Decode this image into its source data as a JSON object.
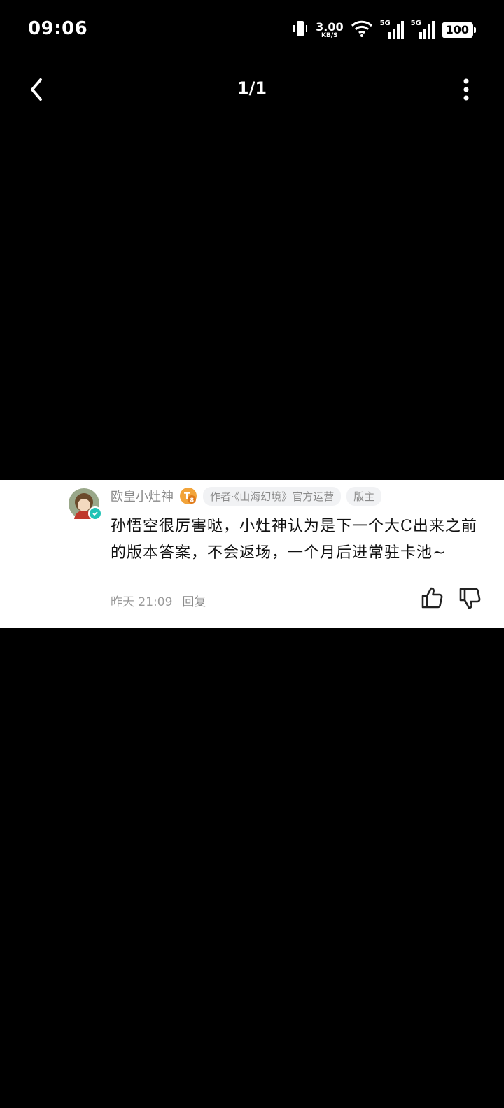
{
  "status_bar": {
    "time": "09:06",
    "net_speed": "3.00",
    "net_unit": "KB/S",
    "signal_1": "5G",
    "signal_2": "5G",
    "battery": "100"
  },
  "top_bar": {
    "page_counter": "1/1",
    "back_icon": "back-arrow-icon",
    "more_icon": "more-vertical-icon"
  },
  "comment": {
    "username": "欧皇小灶神",
    "level_badge": "T8",
    "author_tag": "作者·《山海幻境》官方运营",
    "moderator_tag": "版主",
    "text": "孙悟空很厉害哒，小灶神认为是下一个大C出来之前的版本答案，不会返场，一个月后进常驻卡池~",
    "time": "昨天 21:09",
    "reply_label": "回复"
  },
  "colors": {
    "background": "#000000",
    "card": "#ffffff",
    "verified": "#1fc3b6",
    "level_badge": "#f2a43a"
  }
}
